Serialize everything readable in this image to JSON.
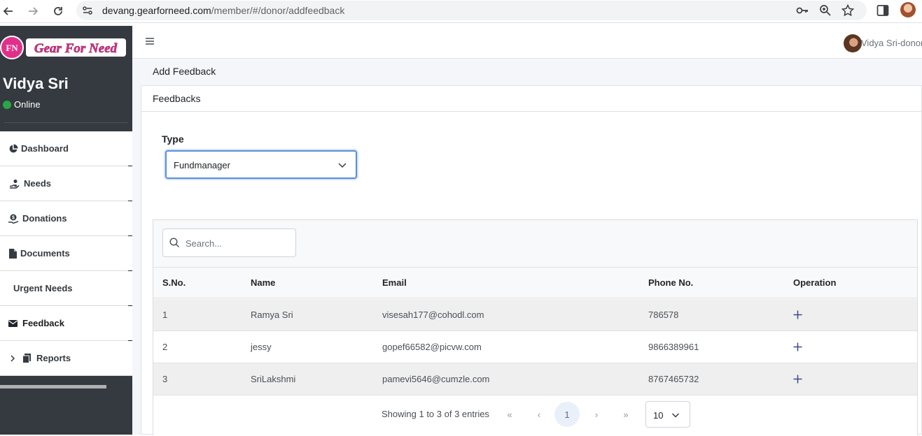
{
  "browser": {
    "url_domain": "devang.gearforneed.com",
    "url_path": "/member/#/donor/addfeedback"
  },
  "sidebar": {
    "logo_text": "Gear For Need",
    "user_name": "Vidya Sri",
    "status": "Online",
    "items": [
      {
        "label": "Dashboard",
        "icon": "pie-chart-icon"
      },
      {
        "label": "Needs",
        "icon": "hand-holding-icon"
      },
      {
        "label": "Donations",
        "icon": "donation-icon"
      },
      {
        "label": "Documents",
        "icon": "document-icon"
      },
      {
        "label": "Urgent Needs",
        "icon": ""
      },
      {
        "label": "Feedback",
        "icon": "envelope-icon"
      },
      {
        "label": "Reports",
        "icon": "copy-icon"
      }
    ]
  },
  "topbar": {
    "user_label": "Vidya Sri-donor"
  },
  "page": {
    "breadcrumb": "Add Feedback",
    "card_title": "Feedbacks",
    "type_label": "Type",
    "type_value": "Fundmanager"
  },
  "table": {
    "search_placeholder": "Search...",
    "columns": [
      "S.No.",
      "Name",
      "Email",
      "Phone No.",
      "Operation"
    ],
    "rows": [
      {
        "sno": "1",
        "name": "Ramya Sri",
        "email": "visesah177@cohodl.com",
        "phone": "786578"
      },
      {
        "sno": "2",
        "name": "jessy",
        "email": "gopef66582@picvw.com",
        "phone": "9866389961"
      },
      {
        "sno": "3",
        "name": "SriLakshmi",
        "email": "pamevi5646@cumzle.com",
        "phone": "8767465732"
      }
    ],
    "info": "Showing 1 to 3 of 3 entries",
    "pagination": {
      "first": "«",
      "prev": "‹",
      "current": "1",
      "next": "›",
      "last": "»"
    },
    "per_page": "10"
  },
  "colors": {
    "sidebar_bg": "#343a40",
    "online": "#28a745",
    "accent": "#5b8fd8",
    "plus": "#3b4a8a"
  }
}
